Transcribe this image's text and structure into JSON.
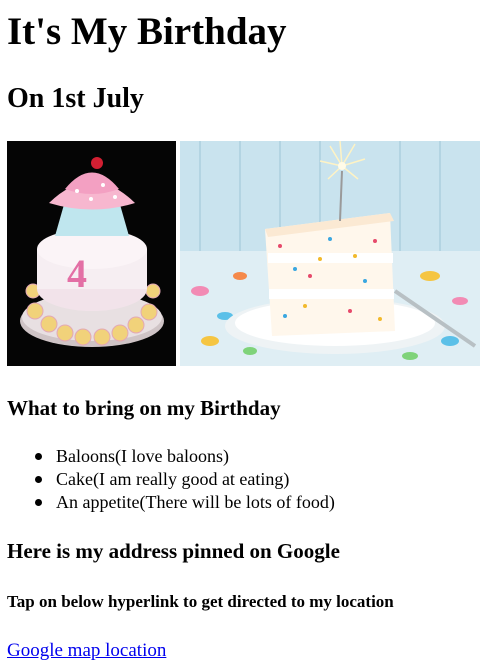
{
  "heading": {
    "title": "It's My Birthday",
    "subtitle": "On 1st July"
  },
  "photos": [
    {
      "icon": "cupcake-cake-photo"
    },
    {
      "icon": "sprinkle-cake-slice-photo"
    }
  ],
  "bring": {
    "title": "What to bring on my Birthday",
    "items": [
      "Baloons(I love baloons)",
      "Cake(I am really good at eating)",
      "An appetite(There will be lots of food)"
    ]
  },
  "address": {
    "title": "Here is my address pinned on Google",
    "instruction": "Tap on below hyperlink to get directed to my location",
    "link_label": "Google map location"
  },
  "colors": {
    "link": "#0000ee",
    "text": "#000000",
    "background": "#ffffff"
  }
}
